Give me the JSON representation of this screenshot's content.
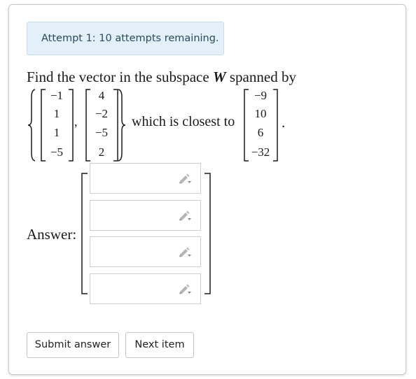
{
  "alert": {
    "text": "Attempt 1: 10 attempts remaining."
  },
  "question": {
    "line1_prefix": "Find the vector in the subspace ",
    "subspace": "W",
    "line1_suffix": " spanned by",
    "comma": ",",
    "middle_text": "which is closest to",
    "period": ".",
    "basis": [
      [
        "−1",
        "1",
        "1",
        "−5"
      ],
      [
        "4",
        "−2",
        "−5",
        "2"
      ]
    ],
    "target": [
      "−9",
      "10",
      "6",
      "−32"
    ]
  },
  "answer": {
    "label": "Answer:",
    "fields": [
      {
        "value": "",
        "icon": "pencil-icon"
      },
      {
        "value": "",
        "icon": "pencil-icon"
      },
      {
        "value": "",
        "icon": "pencil-icon"
      },
      {
        "value": "",
        "icon": "pencil-icon"
      }
    ]
  },
  "buttons": {
    "submit": "Submit answer",
    "next": "Next item"
  }
}
